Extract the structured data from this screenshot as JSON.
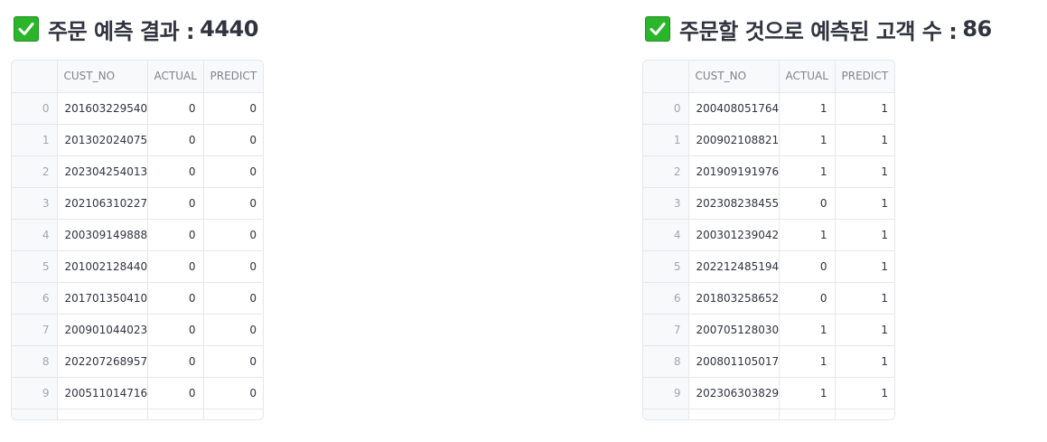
{
  "left_panel": {
    "title": "주문 예측 결과 :",
    "value": "4440",
    "columns": [
      "",
      "CUST_NO",
      "ACTUAL",
      "PREDICT"
    ],
    "rows": [
      {
        "index": "0",
        "cust_no": "201603229540",
        "actual": "0",
        "predict": "0"
      },
      {
        "index": "1",
        "cust_no": "201302024075",
        "actual": "0",
        "predict": "0"
      },
      {
        "index": "2",
        "cust_no": "202304254013",
        "actual": "0",
        "predict": "0"
      },
      {
        "index": "3",
        "cust_no": "202106310227",
        "actual": "0",
        "predict": "0"
      },
      {
        "index": "4",
        "cust_no": "200309149888",
        "actual": "0",
        "predict": "0"
      },
      {
        "index": "5",
        "cust_no": "201002128440",
        "actual": "0",
        "predict": "0"
      },
      {
        "index": "6",
        "cust_no": "201701350410",
        "actual": "0",
        "predict": "0"
      },
      {
        "index": "7",
        "cust_no": "200901044023",
        "actual": "0",
        "predict": "0"
      },
      {
        "index": "8",
        "cust_no": "202207268957",
        "actual": "0",
        "predict": "0"
      },
      {
        "index": "9",
        "cust_no": "200511014716",
        "actual": "0",
        "predict": "0"
      }
    ]
  },
  "right_panel": {
    "title": "주문할 것으로 예측된 고객 수 :",
    "value": "86",
    "columns": [
      "",
      "CUST_NO",
      "ACTUAL",
      "PREDICT"
    ],
    "rows": [
      {
        "index": "0",
        "cust_no": "200408051764",
        "actual": "1",
        "predict": "1"
      },
      {
        "index": "1",
        "cust_no": "200902108821",
        "actual": "1",
        "predict": "1"
      },
      {
        "index": "2",
        "cust_no": "201909191976",
        "actual": "1",
        "predict": "1"
      },
      {
        "index": "3",
        "cust_no": "202308238455",
        "actual": "0",
        "predict": "1"
      },
      {
        "index": "4",
        "cust_no": "200301239042",
        "actual": "1",
        "predict": "1"
      },
      {
        "index": "5",
        "cust_no": "202212485194",
        "actual": "0",
        "predict": "1"
      },
      {
        "index": "6",
        "cust_no": "201803258652",
        "actual": "0",
        "predict": "1"
      },
      {
        "index": "7",
        "cust_no": "200705128030",
        "actual": "1",
        "predict": "1"
      },
      {
        "index": "8",
        "cust_no": "200801105017",
        "actual": "1",
        "predict": "1"
      },
      {
        "index": "9",
        "cust_no": "202306303829",
        "actual": "1",
        "predict": "1"
      }
    ]
  },
  "icons": {
    "heading_check": "check-mark-button-icon"
  },
  "colors": {
    "check_green": "#2bb52b",
    "text": "#31333f",
    "header_text": "#7f838d",
    "grid_border": "#e6e7ea"
  }
}
